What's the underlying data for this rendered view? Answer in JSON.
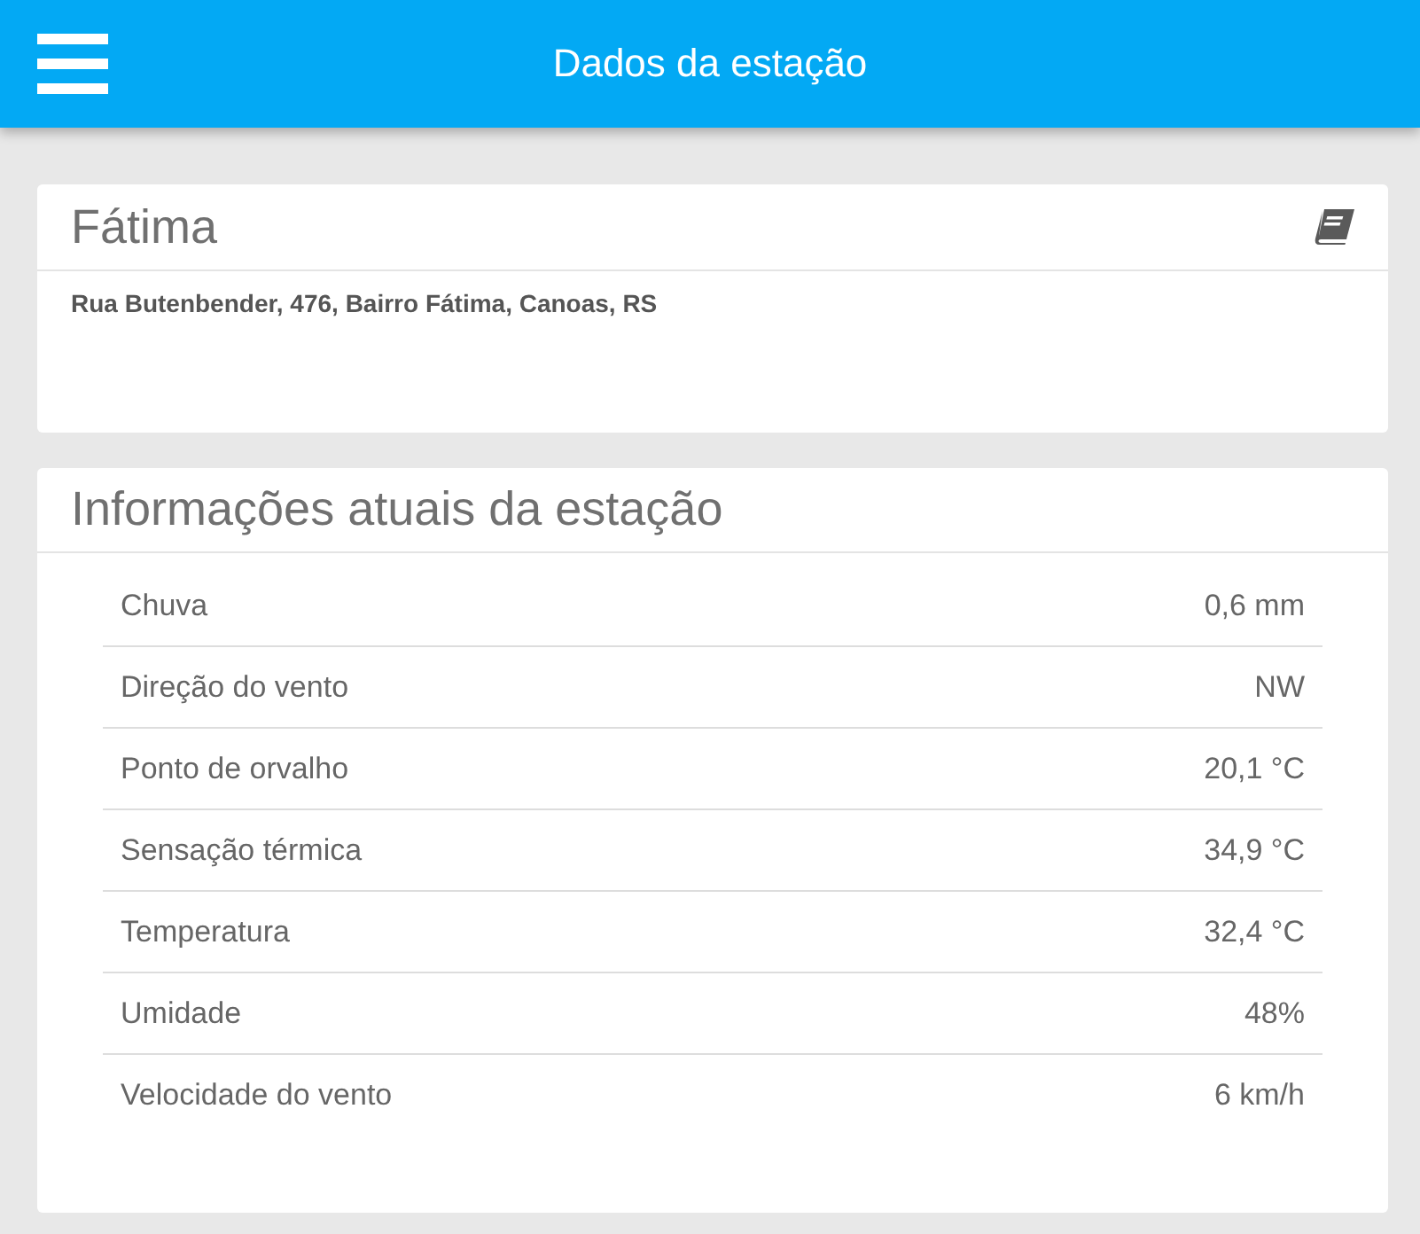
{
  "header": {
    "title": "Dados da estação"
  },
  "station": {
    "name": "Fátima",
    "address": "Rua Butenbender, 476, Bairro Fátima, Canoas, RS"
  },
  "current": {
    "title": "Informações atuais da estação",
    "rows": [
      {
        "label": "Chuva",
        "value": "0,6 mm"
      },
      {
        "label": "Direção do vento",
        "value": "NW"
      },
      {
        "label": "Ponto de orvalho",
        "value": "20,1 °C"
      },
      {
        "label": "Sensação térmica",
        "value": "34,9 °C"
      },
      {
        "label": "Temperatura",
        "value": "32,4 °C"
      },
      {
        "label": "Umidade",
        "value": "48%"
      },
      {
        "label": "Velocidade do vento",
        "value": "6 km/h"
      }
    ]
  }
}
